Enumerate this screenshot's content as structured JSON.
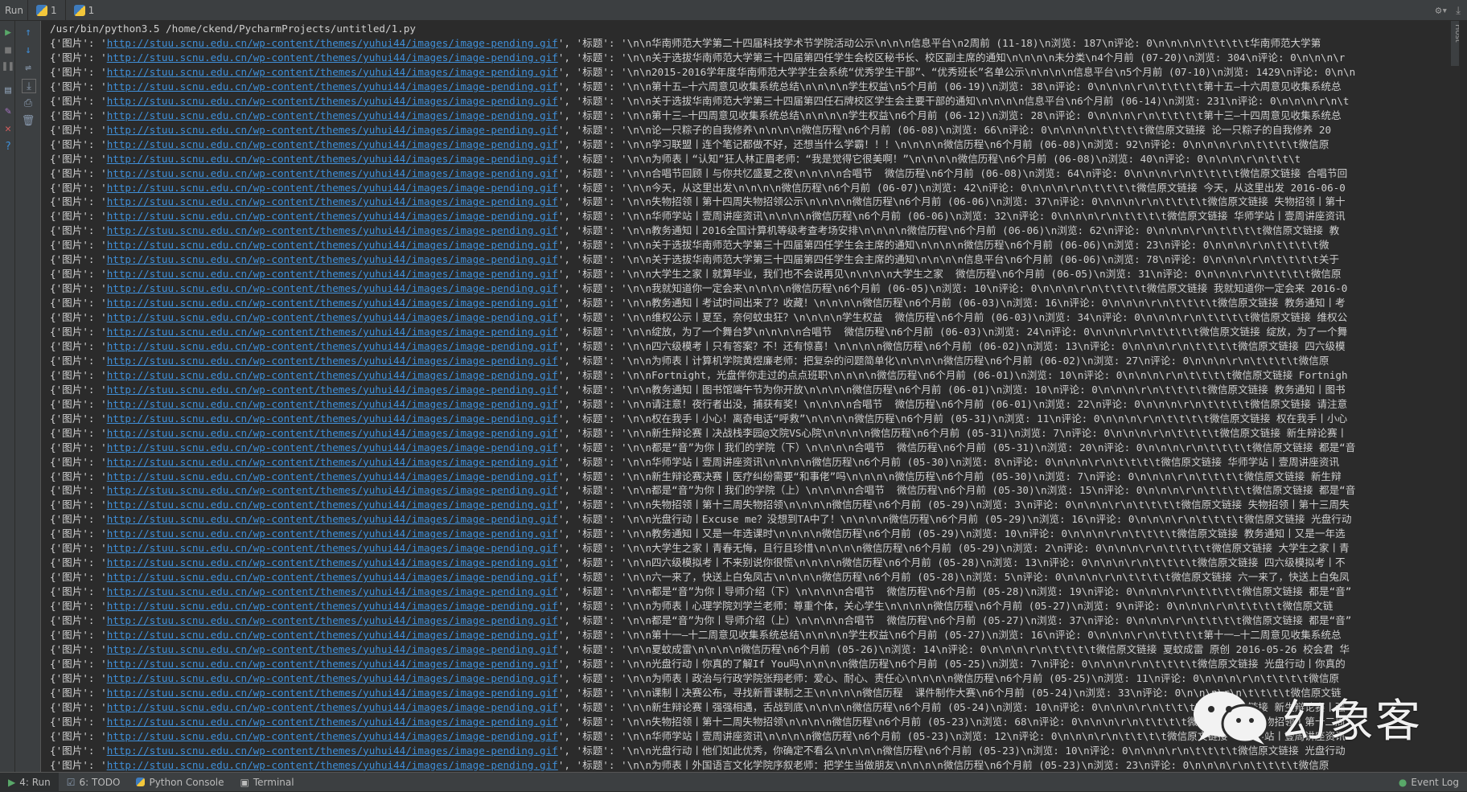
{
  "topbar": {
    "run_label": "Run",
    "tabs": [
      {
        "label": "1"
      },
      {
        "label": "1"
      }
    ],
    "vertical_tab": "Remote Host"
  },
  "console": {
    "command": "/usr/bin/python3.5 /home/ckend/PycharmProjects/untitled/1.py",
    "image_key": "{'图片': '",
    "url": "http://stuu.scnu.edu.cn/wp-content/themes/yuhui44/images/image-pending.gif",
    "title_key": "', '标题': '",
    "rows": [
      "\\n\\n华南师范大学第二十四届科技学术节学院活动公示\\n\\n\\n信息平台\\n2周前 (11-18)\\n浏览: 187\\n评论: 0\\n\\n\\n\\n\\t\\t\\t\\t华南师范大学第",
      "\\n\\n关于选拔华南师范大学第三十四届第四任学生会校区秘书长、校区副主席的通知\\n\\n\\n\\n未分类\\n4个月前 (07-20)\\n浏览: 304\\n评论: 0\\n\\n\\n\\r",
      "\\n\\n2015-2016学年度华南师范大学学生会系统“优秀学生干部”、“优秀班长”名单公示\\n\\n\\n\\n信息平台\\n5个月前 (07-10)\\n浏览: 1429\\n评论: 0\\n\\n",
      "\\n\\n第十五—十六周意见收集系统总结\\n\\n\\n\\n学生权益\\n5个月前 (06-19)\\n浏览: 38\\n评论: 0\\n\\n\\n\\r\\n\\t\\t\\t\\t第十五—十六周意见收集系统总",
      "\\n\\n关于选拔华南师范大学第三十四届第四任石牌校区学生会主要干部的通知\\n\\n\\n\\n信息平台\\n6个月前 (06-14)\\n浏览: 231\\n评论: 0\\n\\n\\n\\r\\n\\t",
      "\\n\\n第十三—十四周意见收集系统总结\\n\\n\\n\\n学生权益\\n6个月前 (06-12)\\n浏览: 28\\n评论: 0\\n\\n\\n\\r\\n\\t\\t\\t\\t第十三—十四周意见收集系统总",
      "\\n\\n论一只粽子的自我修养\\n\\n\\n\\n微信历程\\n6个月前 (06-08)\\n浏览: 66\\n评论: 0\\n\\n\\n\\n\\t\\t\\t\\t微信原文链接 论一只粽子的自我修养 20",
      "\\n\\n学习联盟丨连个笔记都做不好，还想当什么学霸！！！\\n\\n\\n\\n微信历程\\n6个月前 (06-08)\\n浏览: 92\\n评论: 0\\n\\n\\n\\r\\n\\t\\t\\t\\t微信原",
      "\\n\\n为师表丨“认知”狂人林正眉老师：“我是觉得它很美啊！”\\n\\n\\n\\n微信历程\\n6个月前 (06-08)\\n浏览: 40\\n评论: 0\\n\\n\\n\\r\\n\\t\\t\\t",
      "\\n\\n合唱节回顾丨与你共忆盛夏之夜\\n\\n\\n\\n合唱节  微信历程\\n6个月前 (06-08)\\n浏览: 64\\n评论: 0\\n\\n\\n\\r\\n\\t\\t\\t\\t微信原文链接 合唱节回",
      "\\n\\n今天，从这里出发\\n\\n\\n\\n微信历程\\n6个月前 (06-07)\\n浏览: 42\\n评论: 0\\n\\n\\n\\r\\n\\t\\t\\t\\t微信原文链接 今天，从这里出发 2016-06-0",
      "\\n\\n失物招领丨第十四周失物招领公示\\n\\n\\n\\n微信历程\\n6个月前 (06-06)\\n浏览: 37\\n评论: 0\\n\\n\\n\\r\\n\\t\\t\\t\\t微信原文链接 失物招领丨第十",
      "\\n\\n华师学站丨壹周讲座资讯\\n\\n\\n\\n微信历程\\n6个月前 (06-06)\\n浏览: 32\\n评论: 0\\n\\n\\n\\r\\n\\t\\t\\t\\t微信原文链接 华师学站丨壹周讲座资讯",
      "\\n\\n教务通知丨2016全国计算机等级考查考场安排\\n\\n\\n\\n微信历程\\n6个月前 (06-06)\\n浏览: 62\\n评论: 0\\n\\n\\n\\r\\n\\t\\t\\t\\t微信原文链接 教",
      "\\n\\n关于选拔华南师范大学第三十四届第四任学生会主席的通知\\n\\n\\n\\n微信历程\\n6个月前 (06-06)\\n浏览: 23\\n评论: 0\\n\\n\\n\\r\\n\\t\\t\\t\\t微",
      "\\n\\n关于选拔华南师范大学第三十四届第四任学生会主席的通知\\n\\n\\n\\n信息平台\\n6个月前 (06-06)\\n浏览: 78\\n评论: 0\\n\\n\\n\\r\\n\\t\\t\\t\\t关于",
      "\\n\\n大学生之家丨就算毕业，我们也不会说再见\\n\\n\\n\\n大学生之家  微信历程\\n6个月前 (06-05)\\n浏览: 31\\n评论: 0\\n\\n\\n\\r\\n\\t\\t\\t\\t微信原",
      "\\n\\n我就知道你一定会来\\n\\n\\n\\n微信历程\\n6个月前 (06-05)\\n浏览: 10\\n评论: 0\\n\\n\\n\\r\\n\\t\\t\\t\\t微信原文链接 我就知道你一定会来 2016-0",
      "\\n\\n教务通知丨考试时间出来了？收藏！\\n\\n\\n\\n微信历程\\n6个月前 (06-03)\\n浏览: 16\\n评论: 0\\n\\n\\n\\r\\n\\t\\t\\t\\t微信原文链接 教务通知丨考",
      "\\n\\n维权公示丨夏至，奈何蚊虫狂？\\n\\n\\n\\n学生权益  微信历程\\n6个月前 (06-03)\\n浏览: 34\\n评论: 0\\n\\n\\n\\r\\n\\t\\t\\t\\t微信原文链接 维权公",
      "\\n\\n绽放，为了一个舞台梦\\n\\n\\n\\n合唱节  微信历程\\n6个月前 (06-03)\\n浏览: 24\\n评论: 0\\n\\n\\n\\r\\n\\t\\t\\t\\t微信原文链接 绽放，为了一个舞",
      "\\n\\n四六级模考丨只有答案？不！还有惊喜！\\n\\n\\n\\n微信历程\\n6个月前 (06-02)\\n浏览: 13\\n评论: 0\\n\\n\\n\\r\\n\\t\\t\\t\\t微信原文链接 四六级模",
      "\\n\\n为师表丨计算机学院黄煜廉老师：把复杂的问题简单化\\n\\n\\n\\n微信历程\\n6个月前 (06-02)\\n浏览: 27\\n评论: 0\\n\\n\\n\\r\\n\\t\\t\\t\\t微信原",
      "\\n\\nFortnight，光盘伴你走过的点点班职\\n\\n\\n\\n微信历程\\n6个月前 (06-01)\\n浏览: 10\\n评论: 0\\n\\n\\n\\r\\n\\t\\t\\t\\t微信原文链接 Fortnigh",
      "\\n\\n教务通知丨图书馆端午节为你开放\\n\\n\\n\\n微信历程\\n6个月前 (06-01)\\n浏览: 10\\n评论: 0\\n\\n\\n\\r\\n\\t\\t\\t\\t微信原文链接 教务通知丨图书",
      "\\n\\n请注意！夜行者出没，捕获有奖！\\n\\n\\n\\n合唱节  微信历程\\n6个月前 (06-01)\\n浏览: 22\\n评论: 0\\n\\n\\n\\r\\n\\t\\t\\t\\t微信原文链接 请注意",
      "\\n\\n权在我手丨小心！离奇电话“呼救”\\n\\n\\n\\n微信历程\\n6个月前 (05-31)\\n浏览: 11\\n评论: 0\\n\\n\\n\\r\\n\\t\\t\\t\\t微信原文链接 权在我手丨小心",
      "\\n\\n新生辩论赛丨决战栈李园@文院VS心院\\n\\n\\n\\n微信历程\\n6个月前 (05-31)\\n浏览: 7\\n评论: 0\\n\\n\\n\\r\\n\\t\\t\\t\\t微信原文链接 新生辩论赛丨",
      "\\n\\n都是“音”为你丨我们的学院（下）\\n\\n\\n\\n合唱节  微信历程\\n6个月前 (05-31)\\n浏览: 20\\n评论: 0\\n\\n\\n\\r\\n\\t\\t\\t\\t微信原文链接 都是“音",
      "\\n\\n华师学站丨壹周讲座资讯\\n\\n\\n\\n微信历程\\n6个月前 (05-30)\\n浏览: 8\\n评论: 0\\n\\n\\n\\r\\n\\t\\t\\t\\t微信原文链接 华师学站丨壹周讲座资讯",
      "\\n\\n新生辩论赛决赛丨医疗纠纷需要“和事佬”吗\\n\\n\\n\\n微信历程\\n6个月前 (05-30)\\n浏览: 7\\n评论: 0\\n\\n\\n\\r\\n\\t\\t\\t\\t微信原文链接 新生辩",
      "\\n\\n都是“音”为你丨我们的学院（上）\\n\\n\\n\\n合唱节  微信历程\\n6个月前 (05-30)\\n浏览: 15\\n评论: 0\\n\\n\\n\\r\\n\\t\\t\\t\\t微信原文链接 都是“音",
      "\\n\\n失物招领丨第十三周失物招领\\n\\n\\n\\n微信历程\\n6个月前 (05-29)\\n浏览: 3\\n评论: 0\\n\\n\\n\\r\\n\\t\\t\\t\\t微信原文链接 失物招领丨第十三周失",
      "\\n\\n光盘行动丨Excuse me？没想到TA中了！\\n\\n\\n\\n微信历程\\n6个月前 (05-29)\\n浏览: 16\\n评论: 0\\n\\n\\n\\r\\n\\t\\t\\t\\t微信原文链接 光盘行动",
      "\\n\\n教务通知丨又是一年选课时\\n\\n\\n\\n微信历程\\n6个月前 (05-29)\\n浏览: 10\\n评论: 0\\n\\n\\n\\r\\n\\t\\t\\t\\t微信原文链接 教务通知丨又是一年选",
      "\\n\\n大学生之家丨青春无悔，且行且珍惜\\n\\n\\n\\n微信历程\\n6个月前 (05-29)\\n浏览: 2\\n评论: 0\\n\\n\\n\\r\\n\\t\\t\\t\\t微信原文链接 大学生之家丨青",
      "\\n\\n四六级模拟考丨不来别说你很慌\\n\\n\\n\\n微信历程\\n6个月前 (05-28)\\n浏览: 13\\n评论: 0\\n\\n\\n\\r\\n\\t\\t\\t\\t微信原文链接 四六级模拟考丨不",
      "\\n\\n六一来了，快送上白兔凤古\\n\\n\\n\\n微信历程\\n6个月前 (05-28)\\n浏览: 5\\n评论: 0\\n\\n\\n\\r\\n\\t\\t\\t\\t微信原文链接 六一来了，快送上白兔凤",
      "\\n\\n都是“音”为你丨导师介绍（下）\\n\\n\\n\\n合唱节  微信历程\\n6个月前 (05-28)\\n浏览: 19\\n评论: 0\\n\\n\\n\\r\\n\\t\\t\\t\\t微信原文链接 都是“音”",
      "\\n\\n为师表丨心理学院刘学兰老师：尊重个体，关心学生\\n\\n\\n\\n微信历程\\n6个月前 (05-27)\\n浏览: 9\\n评论: 0\\n\\n\\n\\r\\n\\t\\t\\t\\t微信原文链",
      "\\n\\n都是“音”为你丨导师介绍（上）\\n\\n\\n\\n合唱节  微信历程\\n6个月前 (05-27)\\n浏览: 37\\n评论: 0\\n\\n\\n\\r\\n\\t\\t\\t\\t微信原文链接 都是“音”",
      "\\n\\n第十一—十二周意见收集系统总结\\n\\n\\n\\n学生权益\\n6个月前 (05-27)\\n浏览: 16\\n评论: 0\\n\\n\\n\\r\\n\\t\\t\\t\\t第十一—十二周意见收集系统总",
      "\\n\\n夏蚊成雷\\n\\n\\n\\n微信历程\\n6个月前 (05-26)\\n浏览: 14\\n评论: 0\\n\\n\\n\\r\\n\\t\\t\\t\\t微信原文链接 夏蚊成雷 原创 2016-05-26 校会君 华",
      "\\n\\n光盘行动丨你真的了解If You吗\\n\\n\\n\\n微信历程\\n6个月前 (05-25)\\n浏览: 7\\n评论: 0\\n\\n\\n\\r\\n\\t\\t\\t\\t微信原文链接 光盘行动丨你真的",
      "\\n\\n为师表丨政治与行政学院张翔老师：爱心、耐心、责任心\\n\\n\\n\\n微信历程\\n6个月前 (05-25)\\n浏览: 11\\n评论: 0\\n\\n\\n\\r\\n\\t\\t\\t\\t微信原",
      "\\n\\n课制丨决赛公布，寻找新晋课制之王\\n\\n\\n\\n微信历程  课件制作大赛\\n6个月前 (05-24)\\n浏览: 33\\n评论: 0\\n\\n\\n\\r\\n\\t\\t\\t\\t微信原文链",
      "\\n\\n新生辩论赛丨强强相遇，舌战到底\\n\\n\\n\\n微信历程\\n6个月前 (05-24)\\n浏览: 10\\n评论: 0\\n\\n\\n\\r\\n\\t\\t\\t\\t微信原文链接 新生辩论赛丨强",
      "\\n\\n失物招领丨第十二周失物招领\\n\\n\\n\\n微信历程\\n6个月前 (05-23)\\n浏览: 68\\n评论: 0\\n\\n\\n\\r\\n\\t\\t\\t\\t微信原文链接 失物招领丨第十二周",
      "\\n\\n华师学站丨壹周讲座资讯\\n\\n\\n\\n微信历程\\n6个月前 (05-23)\\n浏览: 12\\n评论: 0\\n\\n\\n\\r\\n\\t\\t\\t\\t微信原文链接 华师学站丨壹周讲座资讯",
      "\\n\\n光盘行动丨他们如此优秀，你确定不看么\\n\\n\\n\\n微信历程\\n6个月前 (05-23)\\n浏览: 10\\n评论: 0\\n\\n\\n\\r\\n\\t\\t\\t\\t微信原文链接 光盘行动",
      "\\n\\n为师表丨外国语言文化学院序叙老师：把学生当做朋友\\n\\n\\n\\n微信历程\\n6个月前 (05-23)\\n浏览: 23\\n评论: 0\\n\\n\\n\\r\\n\\t\\t\\t\\t微信原"
    ]
  },
  "watermark": {
    "text": "幻象客"
  },
  "bottombar": {
    "tabs": [
      {
        "label": "4: Run",
        "icon": "play-icon"
      },
      {
        "label": "6: TODO",
        "icon": "todo-icon"
      },
      {
        "label": "Python Console",
        "icon": "python-icon"
      },
      {
        "label": "Terminal",
        "icon": "terminal-icon"
      }
    ],
    "event_log": "Event Log"
  },
  "colors": {
    "background": "#2b2b2b",
    "toolbar": "#3c3f41",
    "text": "#cfcfcf",
    "link": "#3f8fd8",
    "run_green": "#59a869"
  }
}
